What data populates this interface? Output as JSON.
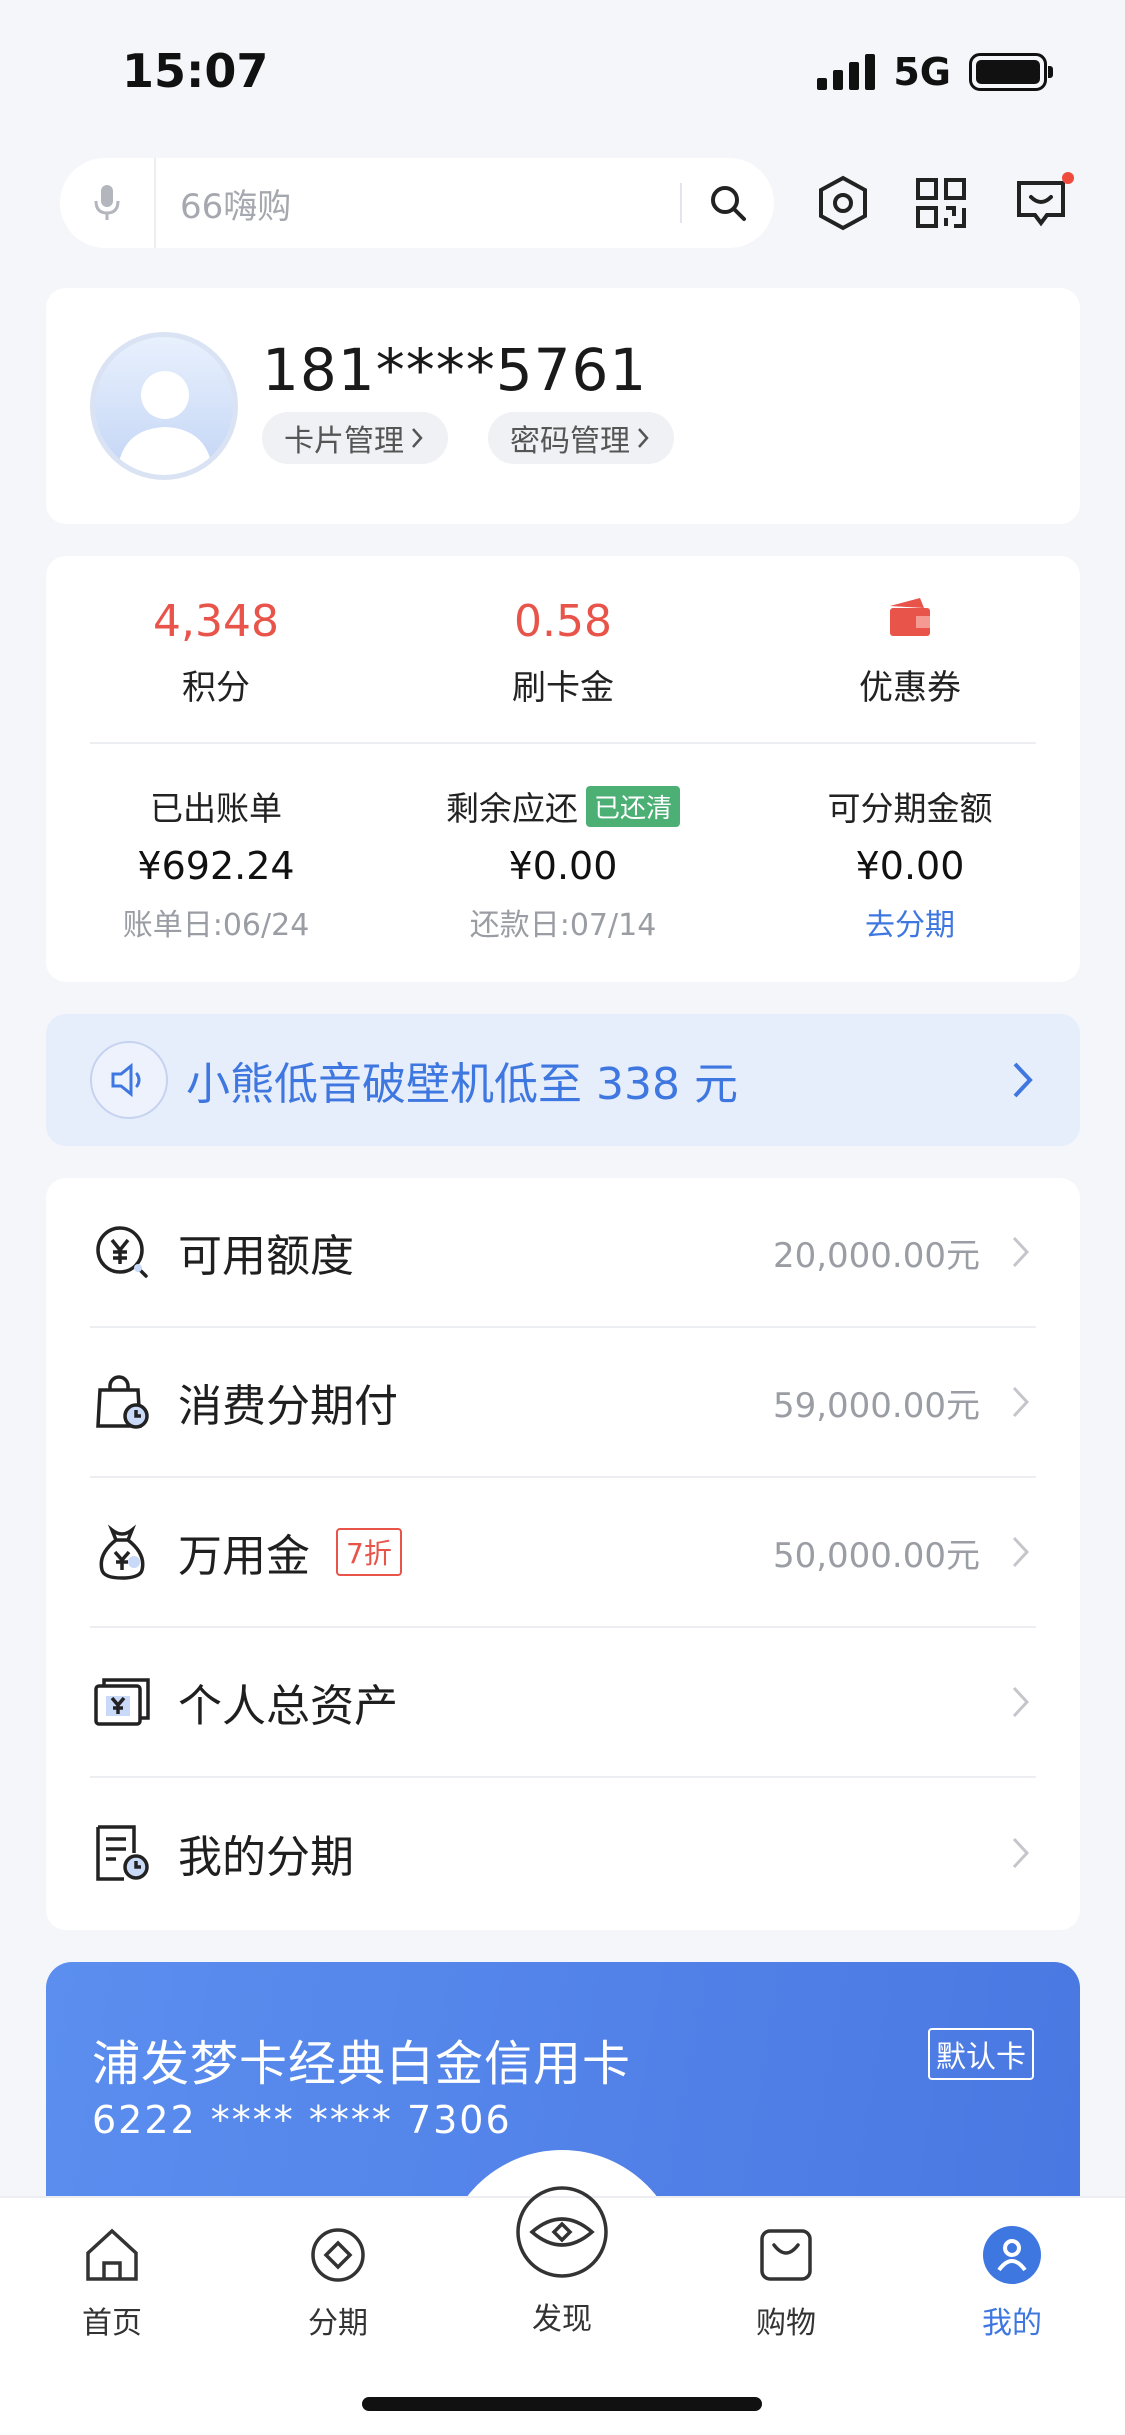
{
  "status_bar": {
    "time": "15:07",
    "network": "5G"
  },
  "search": {
    "placeholder": "66嗨购"
  },
  "profile": {
    "phone": "181****5761",
    "card_mgmt": "卡片管理",
    "pwd_mgmt": "密码管理"
  },
  "stats": [
    {
      "value": "4,348",
      "label": "积分"
    },
    {
      "value": "0.58",
      "label": "刷卡金"
    },
    {
      "label": "优惠券"
    }
  ],
  "bills": [
    {
      "title": "已出账单",
      "amount": "¥692.24",
      "sub": "账单日:06/24"
    },
    {
      "title": "剩余应还",
      "badge": "已还清",
      "amount": "¥0.00",
      "sub": "还款日:07/14"
    },
    {
      "title": "可分期金额",
      "amount": "¥0.00",
      "link": "去分期"
    }
  ],
  "banner": {
    "text": "小熊低音破壁机低至 338 元"
  },
  "list": [
    {
      "label": "可用额度",
      "value": "20,000.00元"
    },
    {
      "label": "消费分期付",
      "value": "59,000.00元"
    },
    {
      "label": "万用金",
      "tag": "7折",
      "value": "50,000.00元"
    },
    {
      "label": "个人总资产"
    },
    {
      "label": "我的分期"
    }
  ],
  "credit_card": {
    "name": "浦发梦卡经典白金信用卡",
    "number": "6222 **** **** 7306",
    "default_label": "默认卡"
  },
  "tabs": [
    {
      "label": "首页"
    },
    {
      "label": "分期"
    },
    {
      "label": "发现"
    },
    {
      "label": "购物"
    },
    {
      "label": "我的"
    }
  ],
  "colors": {
    "accent": "#3f77e0",
    "red": "#e8534a",
    "paid_green": "#4caf74"
  }
}
